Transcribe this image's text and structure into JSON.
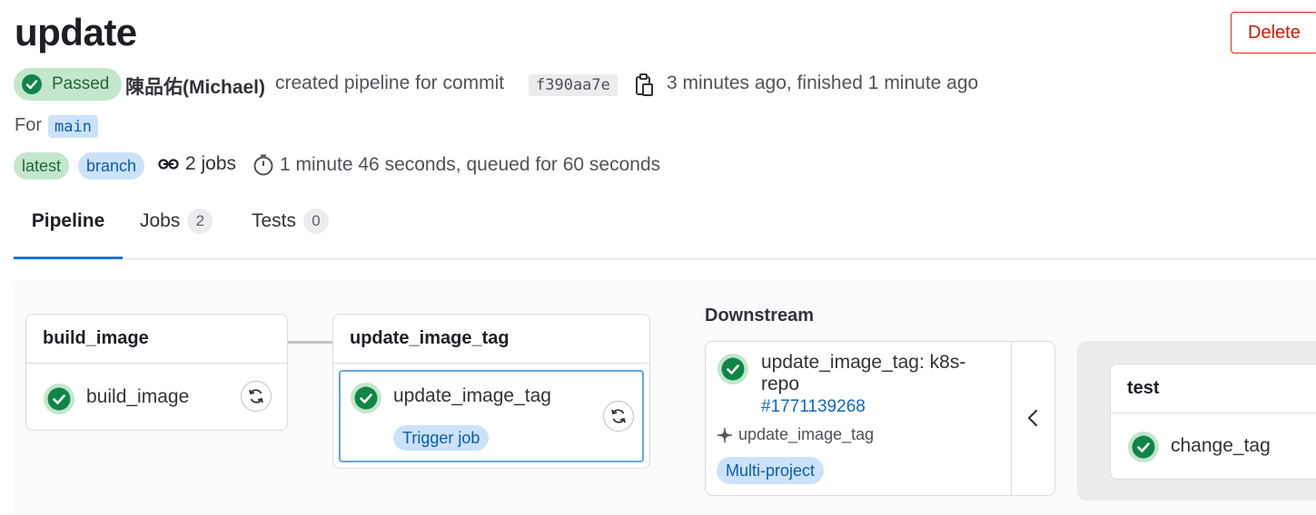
{
  "header": {
    "title": "update",
    "delete_label": "Delete"
  },
  "status": {
    "label": "Passed",
    "color": "#108548"
  },
  "meta": {
    "author": "陳品佑(Michael)",
    "action_text": "created pipeline for commit",
    "commit_sha": "f390aa7e",
    "time_text": "3 minutes ago, finished 1 minute ago",
    "for_label": "For",
    "branch": "main"
  },
  "badges": {
    "latest": "latest",
    "branch": "branch",
    "jobs": "2 jobs",
    "duration": "1 minute 46 seconds, queued for 60 seconds"
  },
  "tabs": [
    {
      "label": "Pipeline",
      "count": null
    },
    {
      "label": "Jobs",
      "count": "2"
    },
    {
      "label": "Tests",
      "count": "0"
    }
  ],
  "stages": [
    {
      "name": "build_image",
      "jobs": [
        {
          "name": "build_image"
        }
      ]
    },
    {
      "name": "update_image_tag",
      "jobs": [
        {
          "name": "update_image_tag",
          "tag": "Trigger job"
        }
      ]
    }
  ],
  "downstream": {
    "label": "Downstream",
    "title": "update_image_tag: k8s-repo",
    "pipeline_id": "#1771139268",
    "source_job": "update_image_tag",
    "type": "Multi-project",
    "stage": {
      "name": "test",
      "job": "change_tag"
    }
  }
}
